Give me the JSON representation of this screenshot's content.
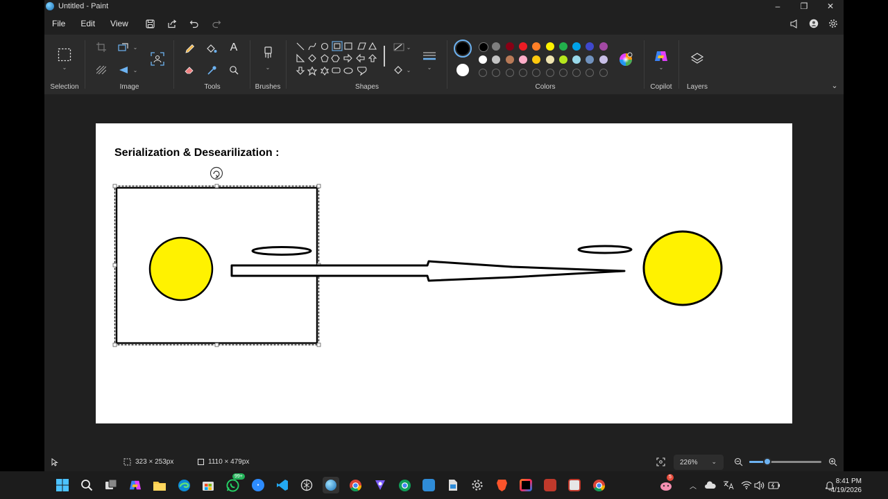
{
  "window": {
    "title": "Untitled - Paint",
    "controls": {
      "minimize": "–",
      "maximize": "❐",
      "close": "✕"
    }
  },
  "menu": {
    "file": "File",
    "edit": "Edit",
    "view": "View"
  },
  "ribbon": {
    "groups": {
      "selection": "Selection",
      "image": "Image",
      "tools": "Tools",
      "brushes": "Brushes",
      "shapes": "Shapes",
      "colors": "Colors",
      "copilot": "Copilot",
      "layers": "Layers"
    },
    "tools_text_glyph": "A",
    "colors": {
      "primary": "#000000",
      "secondary": "#ffffff",
      "row1": [
        "#000000",
        "#7f7f7f",
        "#880015",
        "#ed1c24",
        "#ff7f27",
        "#fff200",
        "#22b14c",
        "#00a2e8",
        "#3f48cc",
        "#a349a4"
      ],
      "row2": [
        "#ffffff",
        "#c3c3c3",
        "#b97a57",
        "#ffaec9",
        "#ffc90e",
        "#efe4b0",
        "#b5e61d",
        "#99d9ea",
        "#7092be",
        "#c8bfe7"
      ],
      "fill": "#fff200"
    }
  },
  "canvas": {
    "heading": "Serialization & Desearilization :"
  },
  "status": {
    "selection_size": "323 × 253px",
    "canvas_size": "1110 × 479px",
    "zoom": "226%",
    "zoom_level_fraction": 0.25
  },
  "taskbar": {
    "whatsapp_badge": "99+",
    "copilot_badge": "5",
    "time": "8:41 PM",
    "date": "4/19/2026"
  }
}
